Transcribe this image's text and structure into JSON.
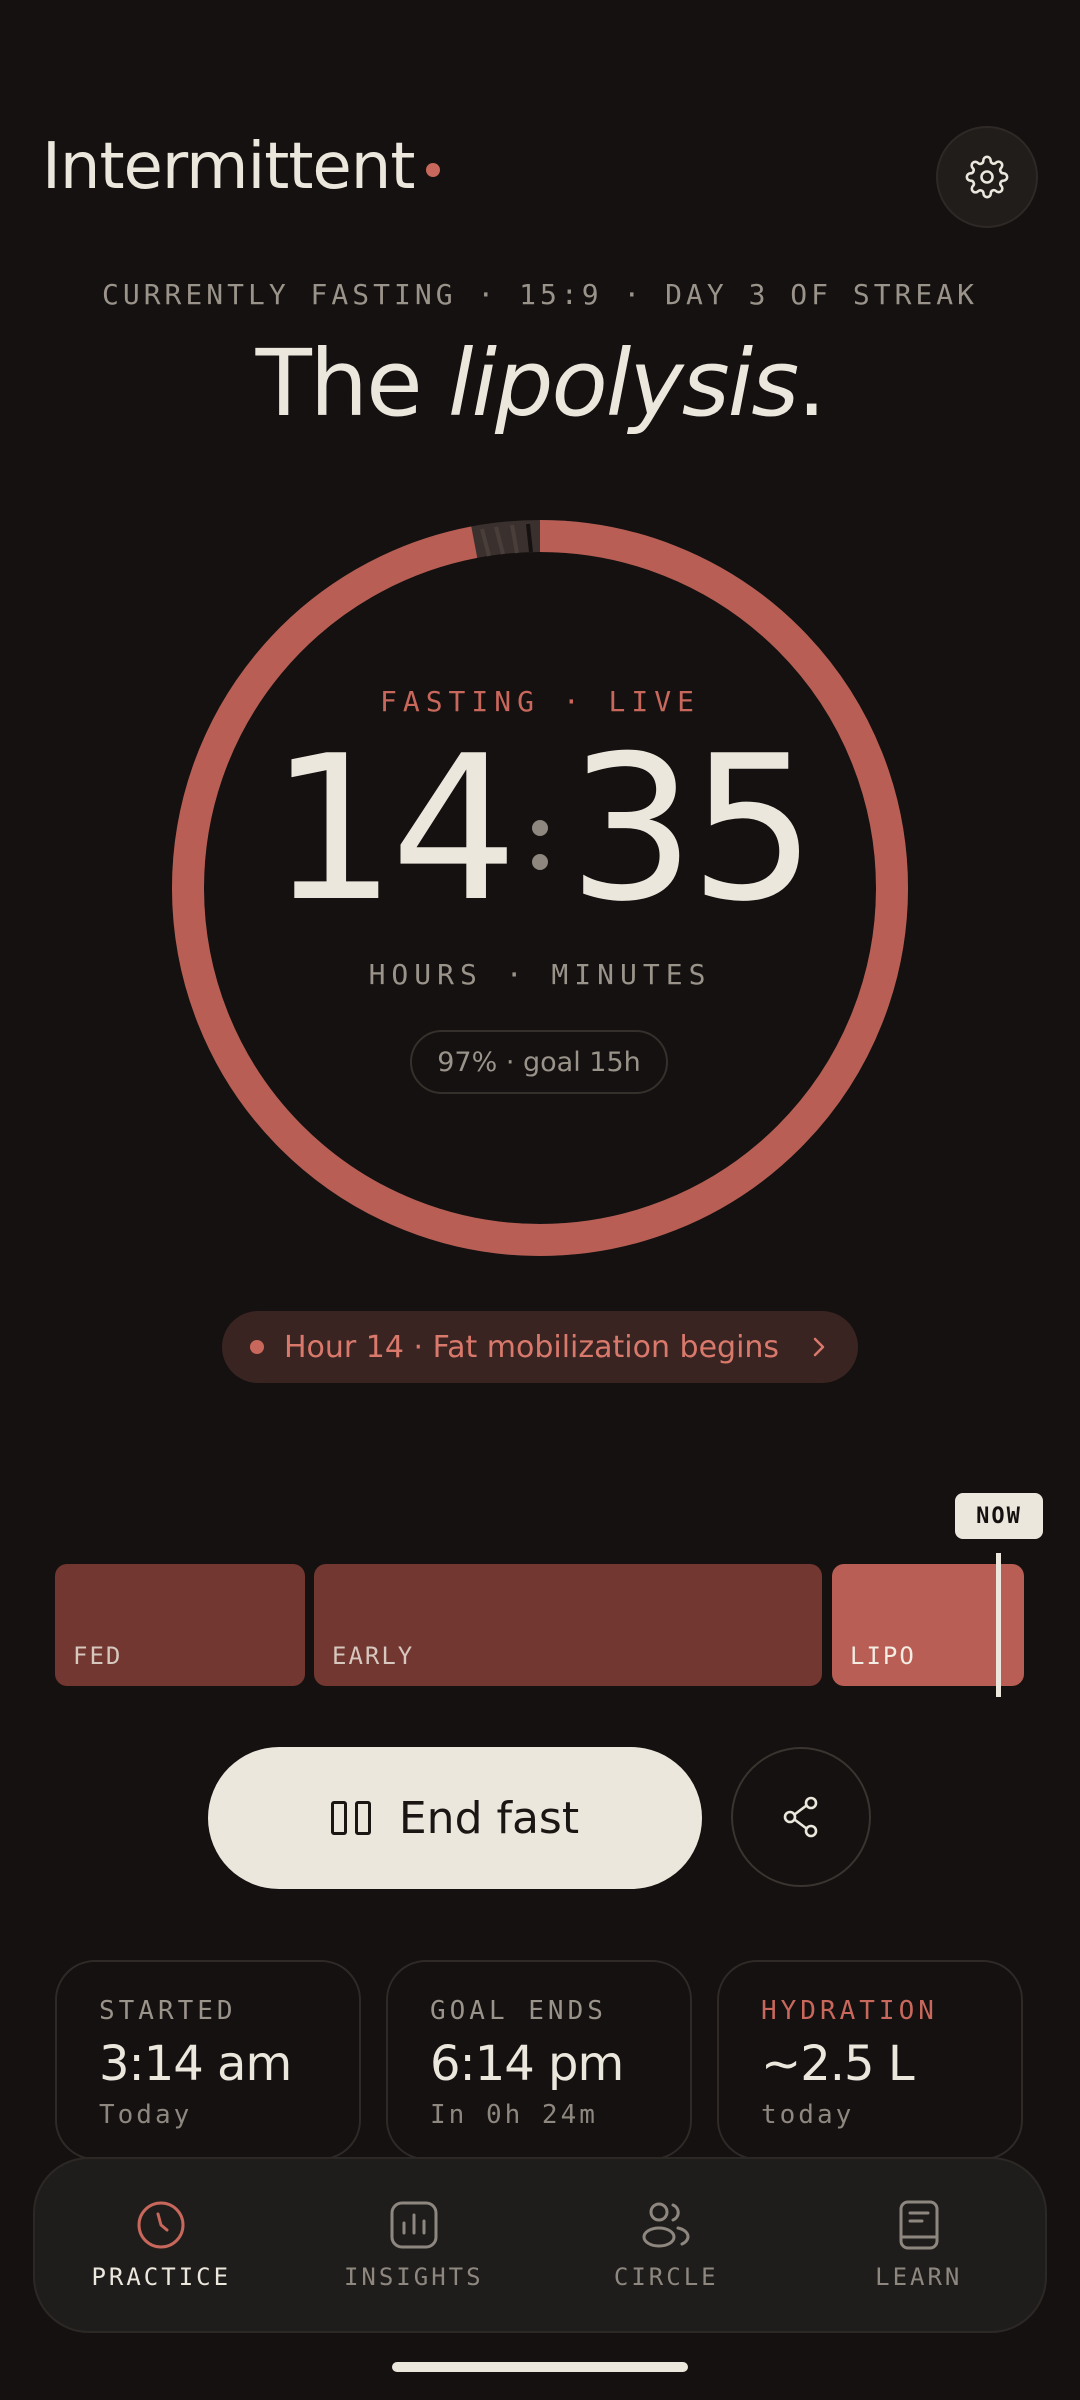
{
  "header": {
    "title": "Intermittent"
  },
  "status_line": "CURRENTLY FASTING · 15:9 · DAY 3 OF STREAK",
  "headline": {
    "prefix": "The",
    "emphasis": "lipolysis",
    "suffix": "."
  },
  "timer": {
    "label": "FASTING · LIVE",
    "hours": "14",
    "minutes": "35",
    "units": "HOURS · MINUTES",
    "goal_pill": "97% · goal 15h",
    "progress_fraction": 0.97
  },
  "milestone": {
    "text": "Hour 14 · Fat mobilization begins"
  },
  "phases": {
    "now_label": "NOW",
    "segments": [
      {
        "label": "FED"
      },
      {
        "label": "EARLY"
      },
      {
        "label": "LIPO"
      }
    ]
  },
  "actions": {
    "end_label": "End fast"
  },
  "stats": [
    {
      "label": "STARTED",
      "value": "3:14 am",
      "sub": "Today"
    },
    {
      "label": "GOAL ENDS",
      "value": "6:14 pm",
      "sub": "In 0h 24m"
    },
    {
      "label": "HYDRATION",
      "value": "~2.5 L",
      "sub": "today"
    }
  ],
  "nav": [
    {
      "label": "PRACTICE",
      "icon": "clock-icon",
      "active": true
    },
    {
      "label": "INSIGHTS",
      "icon": "bar-chart-icon",
      "active": false
    },
    {
      "label": "CIRCLE",
      "icon": "people-icon",
      "active": false
    },
    {
      "label": "LEARN",
      "icon": "book-icon",
      "active": false
    }
  ],
  "colors": {
    "background": "#141110",
    "accent": "#C8675B",
    "text": "#ECE7DD",
    "muted": "#9A938A"
  }
}
